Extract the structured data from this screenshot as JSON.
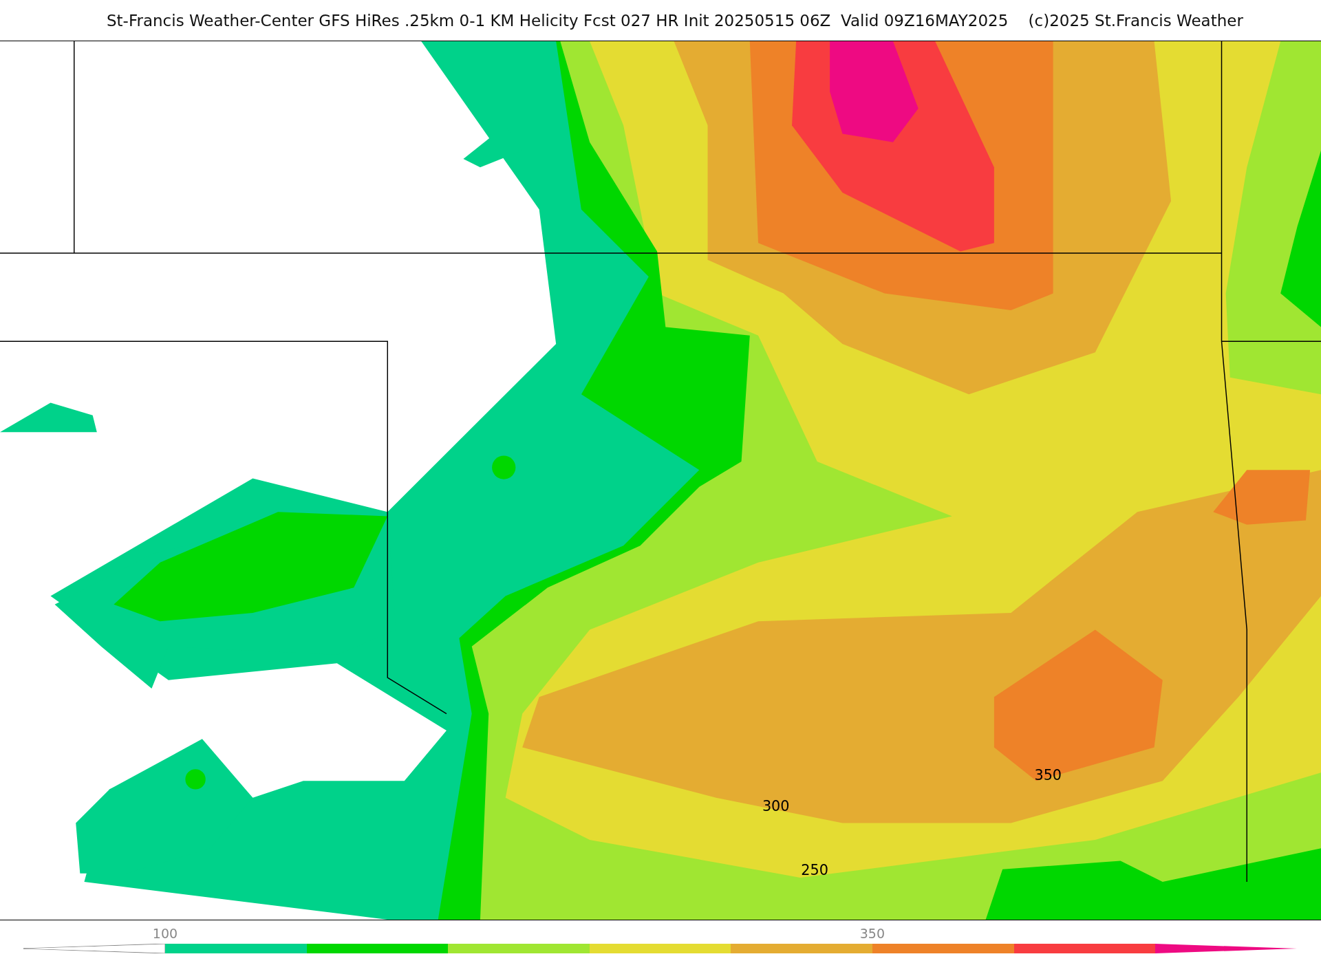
{
  "title": "St-Francis Weather-Center GFS HiRes .25km 0-1 KM Helicity Fcst 027 HR Init 20250515 06Z  Valid 09Z16MAY2025    (c)2025 St.Francis Weather",
  "map": {
    "contour_labels": [
      "350",
      "300",
      "250"
    ]
  },
  "colorbar": {
    "tick_labels": [
      "100",
      "350"
    ],
    "bins": [
      {
        "kind": "under",
        "color": "#ffffff"
      },
      {
        "kind": "bin",
        "color": "#00d28a"
      },
      {
        "kind": "bin",
        "color": "#00d700"
      },
      {
        "kind": "bin",
        "color": "#a0e632"
      },
      {
        "kind": "bin",
        "color": "#e4dc32"
      },
      {
        "kind": "bin",
        "color": "#e4ac32"
      },
      {
        "kind": "bin",
        "color": "#ee8228"
      },
      {
        "kind": "bin",
        "color": "#f83c40"
      },
      {
        "kind": "over",
        "color": "#ee0a82"
      }
    ]
  }
}
